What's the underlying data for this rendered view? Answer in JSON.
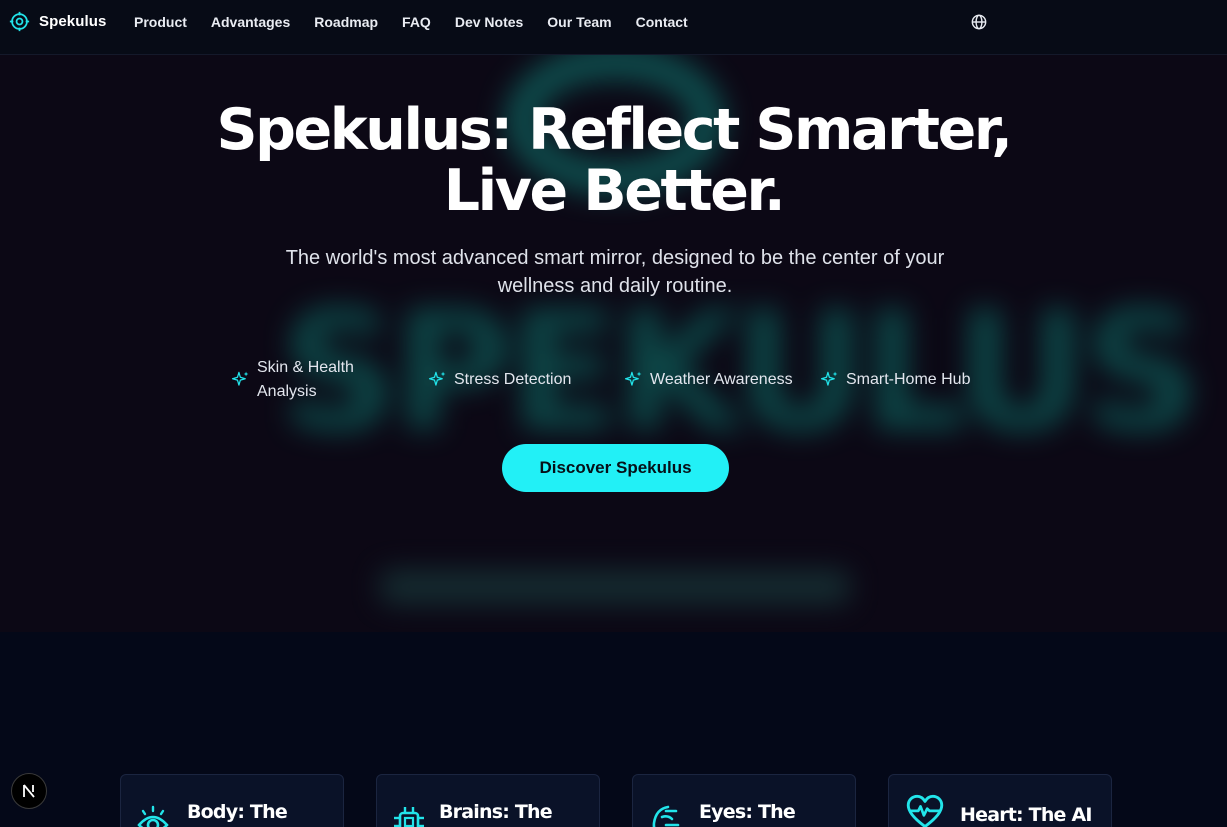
{
  "brand": {
    "name": "Spekulus",
    "icon": "target-icon"
  },
  "nav": {
    "links": [
      "Product",
      "Advantages",
      "Roadmap",
      "FAQ",
      "Dev Notes",
      "Our Team",
      "Contact"
    ],
    "language_icon": "globe-icon"
  },
  "hero": {
    "title_line1": "Spekulus: Reflect Smarter,",
    "title_line2": "Live Better.",
    "subtitle": "The world's most advanced smart mirror, designed to be the center of your wellness and daily routine.",
    "background_word": "SPEKULUS",
    "features": [
      {
        "label": "Skin & Health Analysis",
        "icon": "sparkle-icon"
      },
      {
        "label": "Stress Detection",
        "icon": "sparkle-icon"
      },
      {
        "label": "Weather Awareness",
        "icon": "sparkle-icon"
      },
      {
        "label": "Smart-Home Hub",
        "icon": "sparkle-icon"
      }
    ],
    "cta_label": "Discover Spekulus"
  },
  "cards": [
    {
      "title": "Body: The",
      "icon": "eye-icon"
    },
    {
      "title": "Brains: The",
      "icon": "chip-icon"
    },
    {
      "title": "Eyes: The",
      "icon": "lens-icon"
    },
    {
      "title": "Heart: The AI",
      "icon": "heart-pulse-icon"
    }
  ],
  "badge": {
    "letter": "N"
  },
  "colors": {
    "accent": "#22f0f6",
    "background": "#060a18",
    "hero_background": "#0c0815"
  }
}
